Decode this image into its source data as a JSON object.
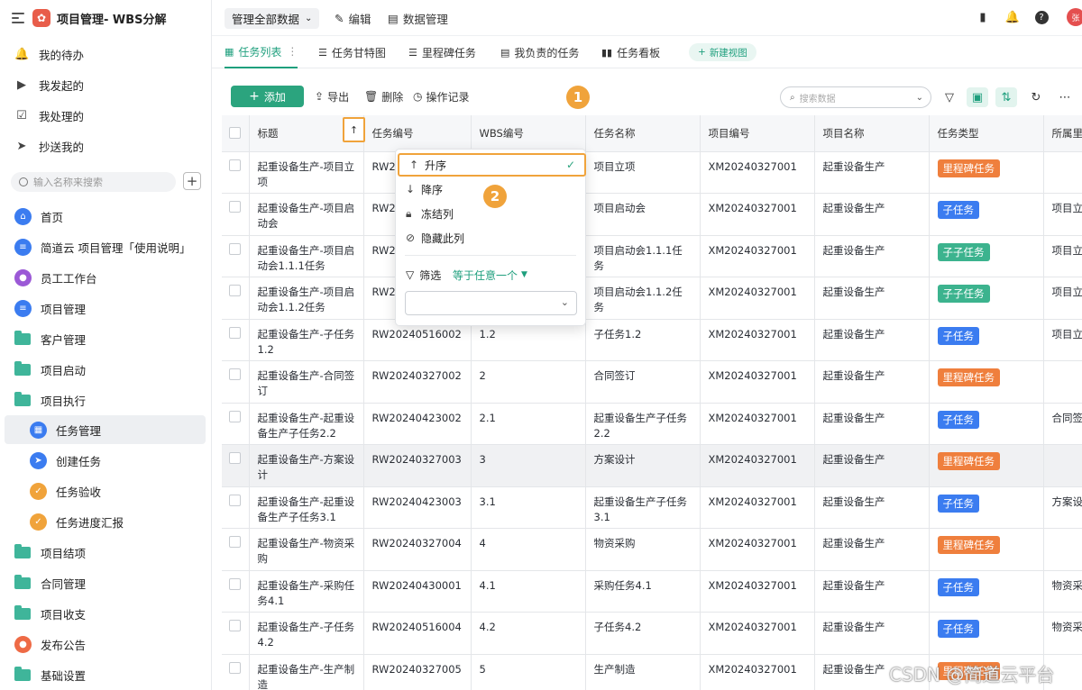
{
  "app": {
    "title": "项目管理- WBS分解"
  },
  "quick_links": [
    {
      "label": "我的待办",
      "icon": "bell-icon"
    },
    {
      "label": "我发起的",
      "icon": "play-circle-icon"
    },
    {
      "label": "我处理的",
      "icon": "inbox-check-icon"
    },
    {
      "label": "抄送我的",
      "icon": "send-icon"
    }
  ],
  "sidebar_search": {
    "placeholder": "输入名称来搜索"
  },
  "nav": [
    {
      "label": "首页",
      "icon": "home-icon"
    },
    {
      "label": "简道云 项目管理「使用说明」",
      "icon": "doc-icon"
    },
    {
      "label": "员工工作台",
      "icon": "user-icon"
    },
    {
      "label": "项目管理",
      "icon": "doc-icon"
    },
    {
      "label": "客户管理",
      "icon": "folder-icon"
    },
    {
      "label": "项目启动",
      "icon": "folder-icon"
    },
    {
      "label": "项目执行",
      "icon": "folder-icon"
    },
    {
      "label": "任务管理",
      "icon": "table-icon"
    },
    {
      "label": "创建任务",
      "icon": "send-icon"
    },
    {
      "label": "任务验收",
      "icon": "shield-icon"
    },
    {
      "label": "任务进度汇报",
      "icon": "shield-icon"
    },
    {
      "label": "项目结项",
      "icon": "folder-icon"
    },
    {
      "label": "合同管理",
      "icon": "folder-icon"
    },
    {
      "label": "项目收支",
      "icon": "folder-icon"
    },
    {
      "label": "发布公告",
      "icon": "user-icon"
    },
    {
      "label": "基础设置",
      "icon": "folder-icon"
    }
  ],
  "topbar": {
    "data_scope": "管理全部数据",
    "edit": "编辑",
    "data_manage": "数据管理",
    "avatar": "张"
  },
  "tabs": [
    {
      "label": "任务列表",
      "icon": "table-icon"
    },
    {
      "label": "任务甘特图",
      "icon": "gantt-icon"
    },
    {
      "label": "里程碑任务",
      "icon": "gantt-icon"
    },
    {
      "label": "我负责的任务",
      "icon": "table-icon"
    },
    {
      "label": "任务看板",
      "icon": "kanban-icon"
    }
  ],
  "new_view": "新建视图",
  "toolbar": {
    "add": "添加",
    "export": "导出",
    "delete": "删除",
    "log": "操作记录",
    "search_placeholder": "搜索数据"
  },
  "columns": [
    "标题",
    "任务编号",
    "WBS编号",
    "任务名称",
    "项目编号",
    "项目名称",
    "任务类型",
    "所属里"
  ],
  "rows": [
    {
      "title": "起重设备生产-项目立项",
      "task_no": "RW20",
      "wbs": "",
      "task_name": "项目立项",
      "project_no": "XM20240327001",
      "project_name": "起重设备生产",
      "type": "里程碑任务",
      "parent": ""
    },
    {
      "title": "起重设备生产-项目启动会",
      "task_no": "RW20",
      "wbs": "",
      "task_name": "项目启动会",
      "project_no": "XM20240327001",
      "project_name": "起重设备生产",
      "type": "子任务",
      "parent": "项目立"
    },
    {
      "title": "起重设备生产-项目启动会1.1.1任务",
      "task_no": "RW20",
      "wbs": "",
      "task_name": "项目启动会1.1.1任务",
      "project_no": "XM20240327001",
      "project_name": "起重设备生产",
      "type": "子子任务",
      "parent": "项目立"
    },
    {
      "title": "起重设备生产-项目启动会1.1.2任务",
      "task_no": "RW20",
      "wbs": "",
      "task_name": "项目启动会1.1.2任务",
      "project_no": "XM20240327001",
      "project_name": "起重设备生产",
      "type": "子子任务",
      "parent": "项目立"
    },
    {
      "title": "起重设备生产-子任务1.2",
      "task_no": "RW20240516002",
      "wbs": "1.2",
      "task_name": "子任务1.2",
      "project_no": "XM20240327001",
      "project_name": "起重设备生产",
      "type": "子任务",
      "parent": "项目立"
    },
    {
      "title": "起重设备生产-合同签订",
      "task_no": "RW20240327002",
      "wbs": "2",
      "task_name": "合同签订",
      "project_no": "XM20240327001",
      "project_name": "起重设备生产",
      "type": "里程碑任务",
      "parent": ""
    },
    {
      "title": "起重设备生产-起重设备生产子任务2.2",
      "task_no": "RW20240423002",
      "wbs": "2.1",
      "task_name": "起重设备生产子任务2.2",
      "project_no": "XM20240327001",
      "project_name": "起重设备生产",
      "type": "子任务",
      "parent": "合同签"
    },
    {
      "title": "起重设备生产-方案设计",
      "task_no": "RW20240327003",
      "wbs": "3",
      "task_name": "方案设计",
      "project_no": "XM20240327001",
      "project_name": "起重设备生产",
      "type": "里程碑任务",
      "parent": ""
    },
    {
      "title": "起重设备生产-起重设备生产子任务3.1",
      "task_no": "RW20240423003",
      "wbs": "3.1",
      "task_name": "起重设备生产子任务3.1",
      "project_no": "XM20240327001",
      "project_name": "起重设备生产",
      "type": "子任务",
      "parent": "方案设"
    },
    {
      "title": "起重设备生产-物资采购",
      "task_no": "RW20240327004",
      "wbs": "4",
      "task_name": "物资采购",
      "project_no": "XM20240327001",
      "project_name": "起重设备生产",
      "type": "里程碑任务",
      "parent": ""
    },
    {
      "title": "起重设备生产-采购任务4.1",
      "task_no": "RW20240430001",
      "wbs": "4.1",
      "task_name": "采购任务4.1",
      "project_no": "XM20240327001",
      "project_name": "起重设备生产",
      "type": "子任务",
      "parent": "物资采"
    },
    {
      "title": "起重设备生产-子任务4.2",
      "task_no": "RW20240516004",
      "wbs": "4.2",
      "task_name": "子任务4.2",
      "project_no": "XM20240327001",
      "project_name": "起重设备生产",
      "type": "子任务",
      "parent": "物资采"
    },
    {
      "title": "起重设备生产-生产制造",
      "task_no": "RW20240327005",
      "wbs": "5",
      "task_name": "生产制造",
      "project_no": "XM20240327001",
      "project_name": "起重设备生产",
      "type": "里程碑任务",
      "parent": ""
    }
  ],
  "type_colors": {
    "里程碑任务": "#ef7f3d",
    "子任务": "#3b7cf0",
    "子子任务": "#3cb38e"
  },
  "column_menu": {
    "items": [
      {
        "label": "升序",
        "icon": "arrow-up-icon",
        "selected": true
      },
      {
        "label": "降序",
        "icon": "arrow-down-icon",
        "selected": false
      },
      {
        "label": "冻结列",
        "icon": "lock-icon",
        "selected": false
      },
      {
        "label": "隐藏此列",
        "icon": "eye-off-icon",
        "selected": false
      }
    ],
    "filter_label": "筛选",
    "filter_condition": "等于任意一个"
  },
  "markers": [
    "1",
    "2"
  ],
  "watermark": "CSDN @简道云平台",
  "accent": "#2ba47e",
  "highlight": "#f0a33b"
}
